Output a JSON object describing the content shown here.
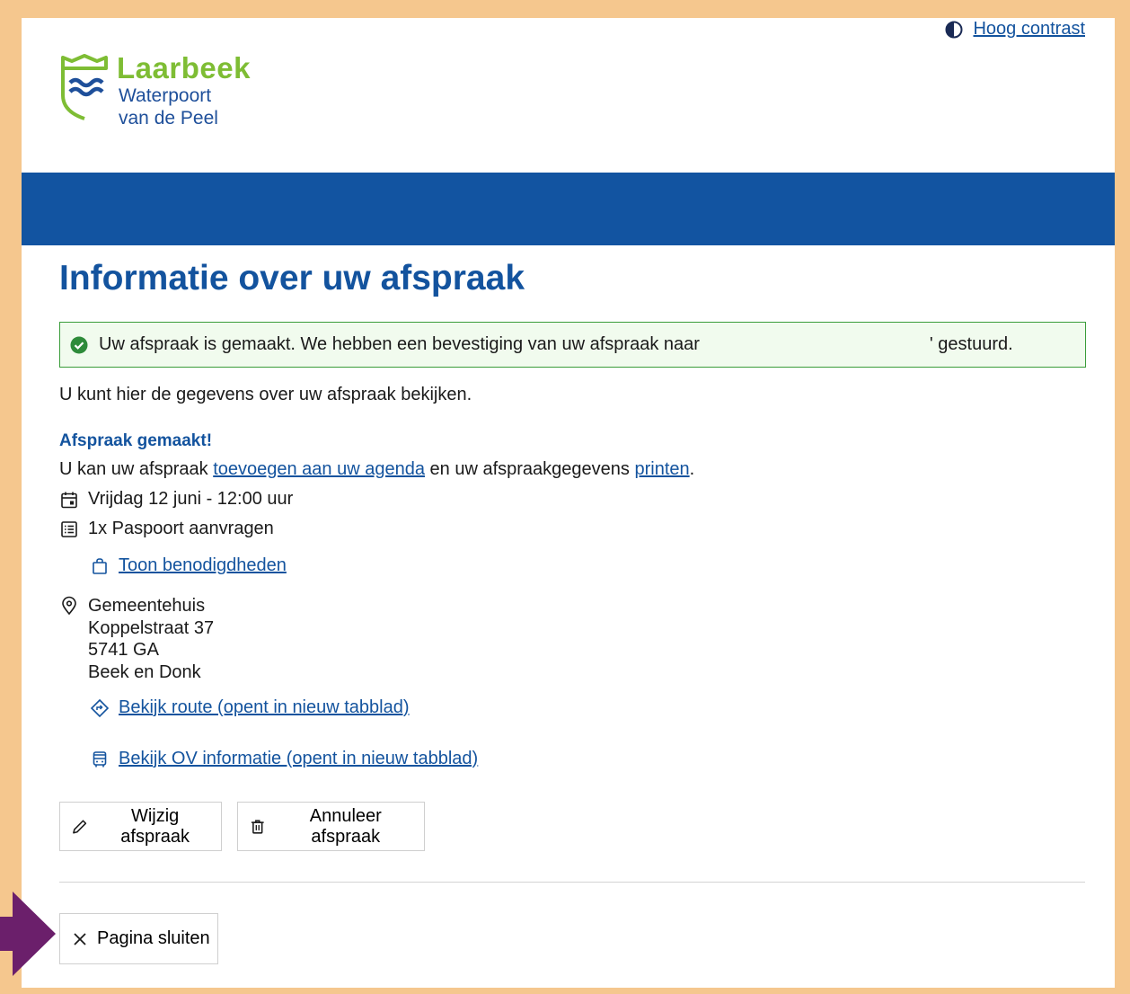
{
  "header": {
    "contrast_label": "Hoog contrast"
  },
  "logo": {
    "name": "Laarbeek",
    "line2": "Waterpoort",
    "line3": "van de Peel"
  },
  "page_title": "Informatie over uw afspraak",
  "alert": {
    "text_before": "Uw afspraak is gemaakt. We hebben een bevestiging van uw afspraak naar",
    "text_after": "' gestuurd."
  },
  "intro": "U kunt hier de gegevens over uw afspraak bekijken.",
  "subheading": "Afspraak gemaakt!",
  "agenda_line": {
    "prefix": "U kan uw afspraak ",
    "agenda_link": "toevoegen aan uw agenda",
    "middle": " en uw afspraakgegevens ",
    "print_link": "printen",
    "suffix": "."
  },
  "appointment": {
    "datetime": "Vrijdag 12 juni - 12:00 uur",
    "product": "1x Paspoort aanvragen",
    "requirements_link": "Toon benodigdheden"
  },
  "location": {
    "name": "Gemeentehuis",
    "street": "Koppelstraat 37",
    "postcode": "5741 GA",
    "city": "Beek en Donk",
    "route_link": "Bekijk route (opent in nieuw tabblad)",
    "ov_link": "Bekijk OV informatie (opent in nieuw tabblad)"
  },
  "buttons": {
    "edit": "Wijzig afspraak",
    "cancel": "Annuleer afspraak",
    "close": "Pagina sluiten"
  },
  "colors": {
    "primary": "#13539e",
    "banner": "#1254a1",
    "success": "#2e8b3a",
    "logo_green": "#7ebd34",
    "frame": "#f5c78e",
    "arrow": "#6b1f6b"
  }
}
